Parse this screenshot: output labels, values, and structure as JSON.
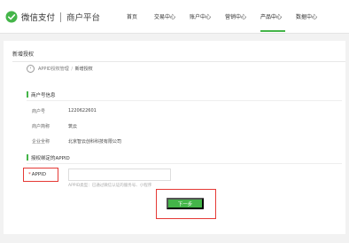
{
  "header": {
    "brand": "微信支付",
    "brand_sub": "商户平台",
    "nav": [
      {
        "label": "首页"
      },
      {
        "label": "交易中心"
      },
      {
        "label": "账户中心"
      },
      {
        "label": "营销中心"
      },
      {
        "label": "产品中心",
        "active": true
      },
      {
        "label": "数据中心"
      }
    ],
    "accent_color": "#44b549"
  },
  "page": {
    "title": "新增授权",
    "breadcrumb": {
      "parent": "APPID授权管理",
      "separator": "/",
      "current": "新增授权"
    }
  },
  "merchant_section": {
    "title": "商户号信息",
    "rows": [
      {
        "label": "商户号",
        "value": "1220622601"
      },
      {
        "label": "商户简称",
        "value": "筑云"
      },
      {
        "label": "企业全称",
        "value": "北京智云创科科技有限公司"
      }
    ]
  },
  "appid_section": {
    "title": "授权绑定的APPID",
    "field_required_mark": "*",
    "field_label": "APPID",
    "input_value": "",
    "hint": "APPID类型：已通过微信认证的服务号、小程序"
  },
  "actions": {
    "next_label": "下一步"
  },
  "highlight_color": "#e53935"
}
